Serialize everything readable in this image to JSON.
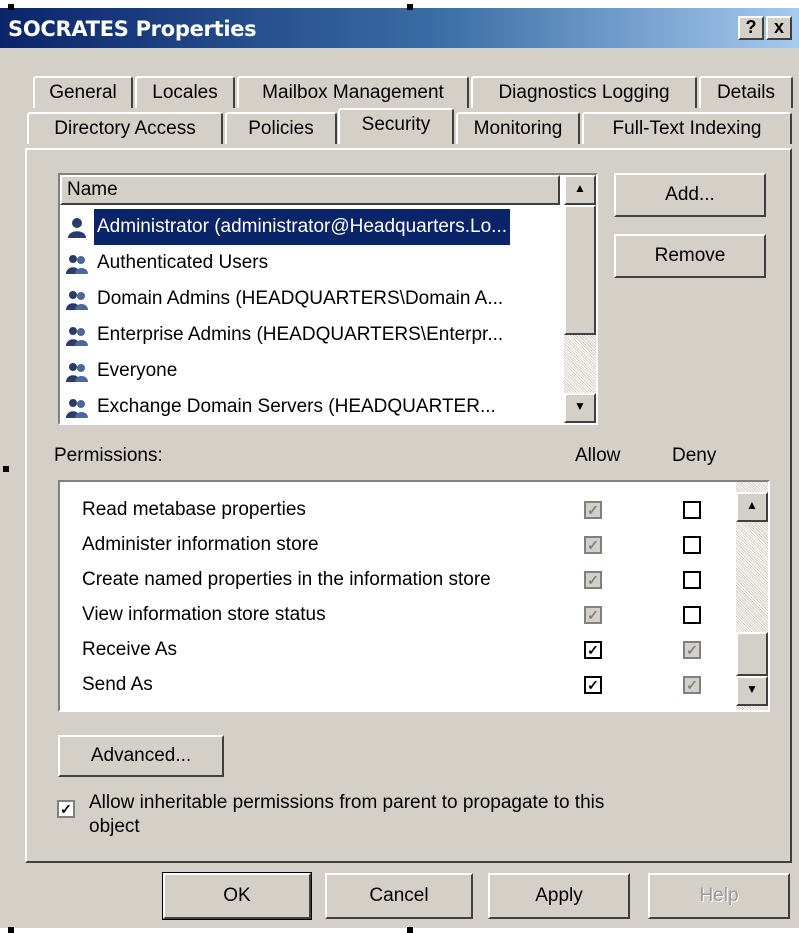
{
  "window": {
    "title": "SOCRATES Properties",
    "help_glyph": "?",
    "close_glyph": "x"
  },
  "tabs_row1": [
    {
      "label": "General"
    },
    {
      "label": "Locales"
    },
    {
      "label": "Mailbox Management"
    },
    {
      "label": "Diagnostics Logging"
    },
    {
      "label": "Details"
    }
  ],
  "tabs_row2": [
    {
      "label": "Directory Access"
    },
    {
      "label": "Policies"
    },
    {
      "label": "Security",
      "active": true
    },
    {
      "label": "Monitoring"
    },
    {
      "label": "Full-Text Indexing"
    }
  ],
  "users": {
    "column_header": "Name",
    "items": [
      {
        "name": "Administrator (administrator@Headquarters.Lo...",
        "selected": true,
        "icon": "user-icon"
      },
      {
        "name": "Authenticated Users",
        "icon": "group-icon"
      },
      {
        "name": "Domain Admins (HEADQUARTERS\\Domain A...",
        "icon": "group-icon"
      },
      {
        "name": "Enterprise Admins (HEADQUARTERS\\Enterpr...",
        "icon": "group-icon"
      },
      {
        "name": "Everyone",
        "icon": "group-icon"
      },
      {
        "name": "Exchange Domain Servers (HEADQUARTER...",
        "icon": "group-icon"
      }
    ],
    "add_button": "Add...",
    "remove_button": "Remove"
  },
  "permissions": {
    "label": "Permissions:",
    "allow_header": "Allow",
    "deny_header": "Deny",
    "rows": [
      {
        "name": "Read metabase properties",
        "allow": "checked-inherited",
        "deny": "unchecked"
      },
      {
        "name": "Administer information store",
        "allow": "checked-inherited",
        "deny": "unchecked"
      },
      {
        "name": "Create named properties in the information store",
        "allow": "checked-inherited",
        "deny": "unchecked"
      },
      {
        "name": "View information store status",
        "allow": "checked-inherited",
        "deny": "unchecked"
      },
      {
        "name": "Receive As",
        "allow": "checked",
        "deny": "checked-inherited"
      },
      {
        "name": "Send As",
        "allow": "checked",
        "deny": "checked-inherited"
      }
    ]
  },
  "advanced_button": "Advanced...",
  "inherit": {
    "checked": true,
    "label_line1": "Allow inheritable permissions from parent to propagate to this",
    "label_line2": "object"
  },
  "footer": {
    "ok": "OK",
    "cancel": "Cancel",
    "apply": "Apply",
    "help": "Help"
  },
  "glyphs": {
    "check": "✓",
    "scroll_up": "▲",
    "scroll_down": "▼"
  }
}
